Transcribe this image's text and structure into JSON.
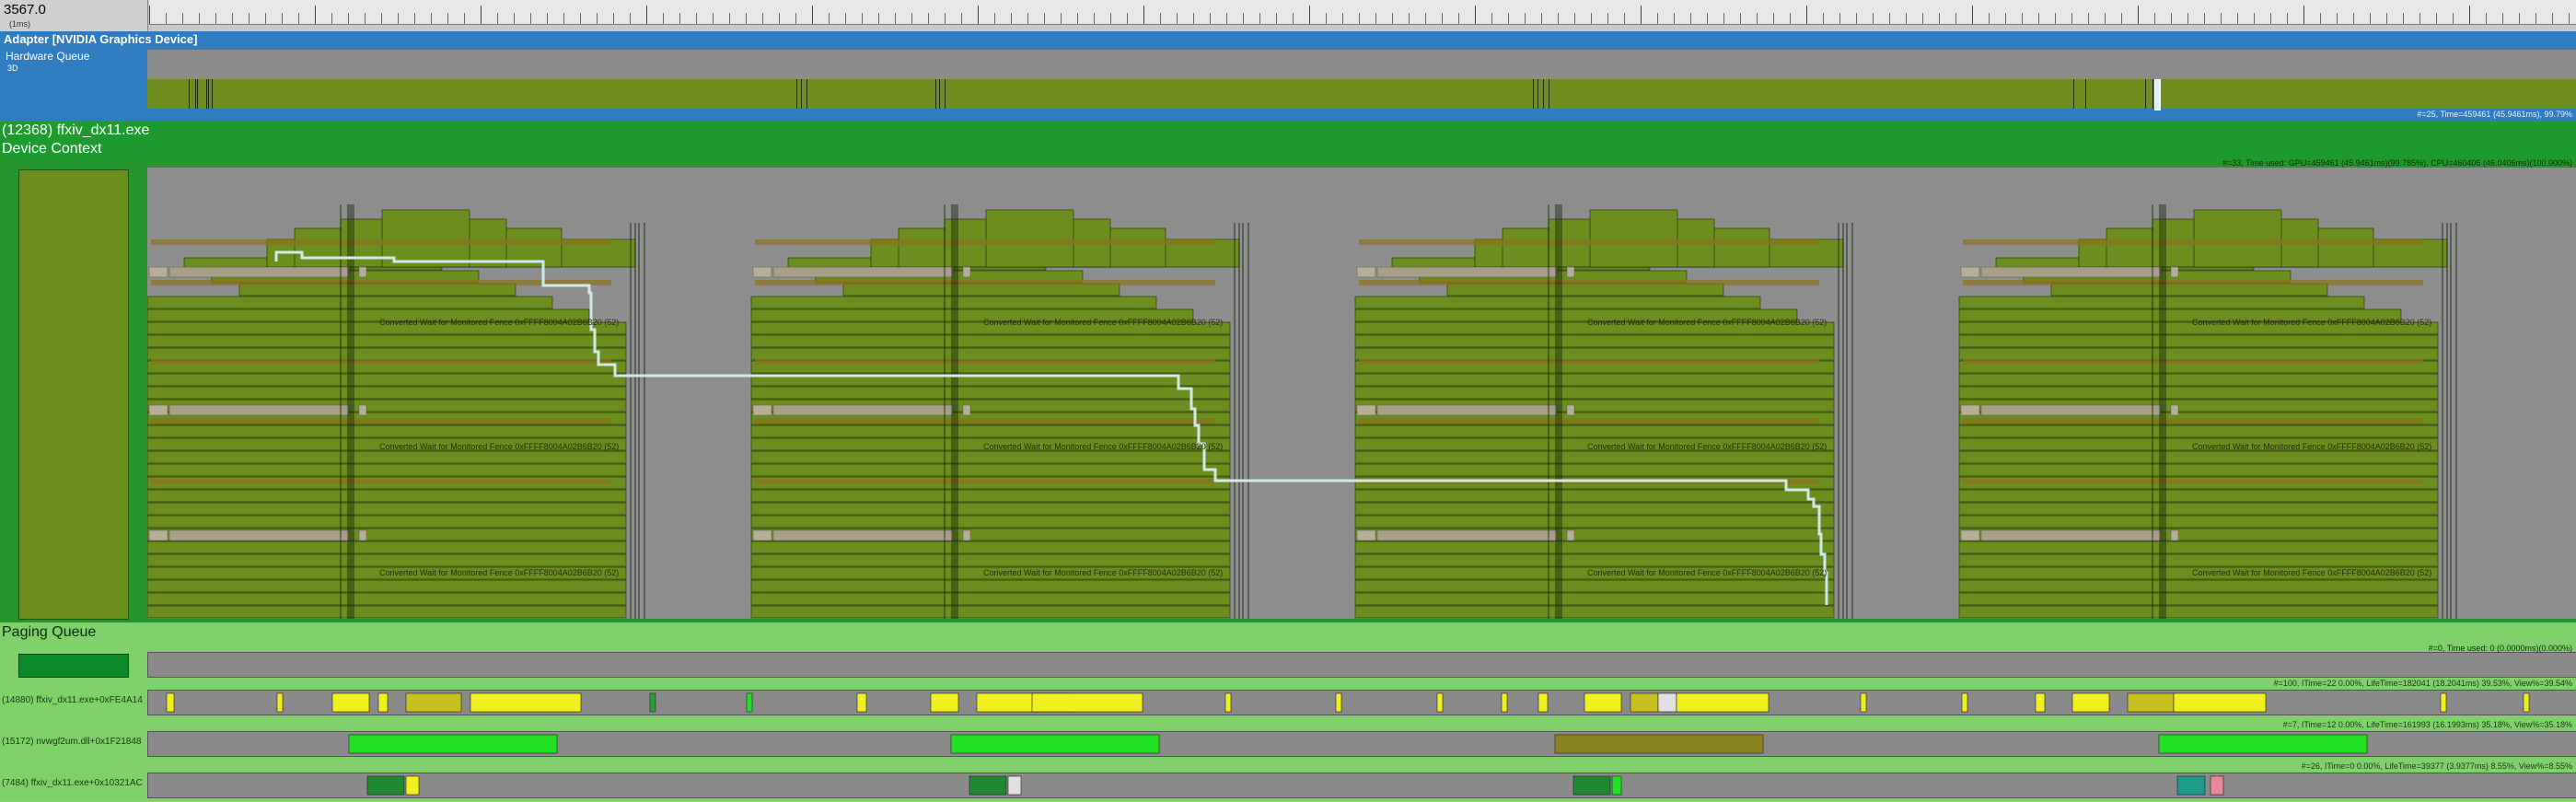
{
  "ruler": {
    "time": "3567.0",
    "unit": "(1ms)"
  },
  "adapter": {
    "title": "Adapter [NVIDIA Graphics Device]",
    "queue_label": "Hardware Queue",
    "queue_sub": "3D",
    "stats": "#=25,  Time=459461 (45.9461ms),  99.79%"
  },
  "process": {
    "title": "(12368) ffxiv_dx11.exe",
    "context_label": "Device Context",
    "stats": "#=33, Time used: GPU=459461 (45.9461ms)(99.785%), CPU=460406 (46.0406ms)(100.000%)"
  },
  "packet_label": "Converted Wait for Monitored Fence 0xFFFF8004A02B6B20 (52)",
  "paging": {
    "label": "Paging Queue",
    "stats": "#=0, Time used: 0 (0.0000ms)(0.000%)"
  },
  "threads": [
    {
      "label": "(14880) ffxiv_dx11.exe+0xFE4A14",
      "stats": "#=100, ITime=22 0.00%, LifeTime=182041 (18.2041ms) 39.53%, View%=39.54%"
    },
    {
      "label": "(15172) nvwgf2um.dll+0x1F21848",
      "stats": "#=7, ITime=12 0.00%, LifeTime=161993 (16.1993ms) 35.18%, View%=35.18%"
    },
    {
      "label": "(7484) ffxiv_dx11.exe+0x10321AC",
      "stats": "#=26, ITime=0 0.00%, LifeTime=39377 (3.9377ms) 8.55%, View%=8.55%"
    }
  ],
  "colors": {
    "lane": "#6b8e1f",
    "lane_dark": "#5f7d18",
    "track": "#8e8e8e",
    "adapter": "#2f7dc0",
    "process": "#1f9a2f",
    "highlight": "#cfe8e8",
    "yellow": "#f0f020",
    "bright_green": "#22e022"
  }
}
